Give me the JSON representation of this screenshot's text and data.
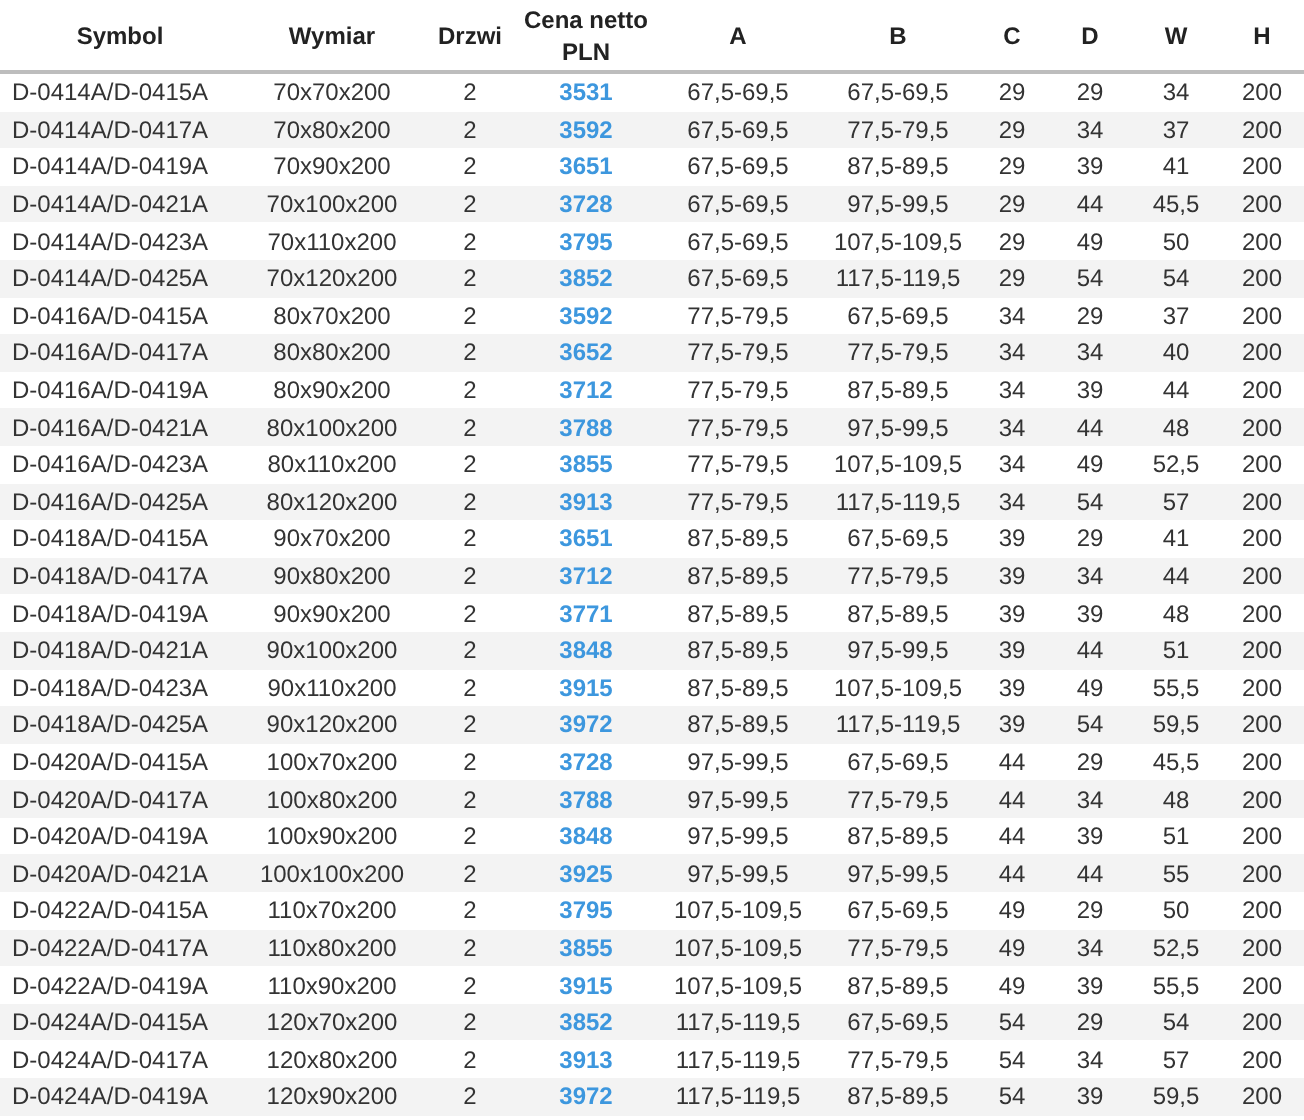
{
  "table": {
    "columns": [
      {
        "label": "Symbol",
        "kind": "text"
      },
      {
        "label": "Wymiar",
        "kind": "text"
      },
      {
        "label": "Drzwi",
        "kind": "text"
      },
      {
        "label": "Cena netto PLN",
        "kind": "price"
      },
      {
        "label": "A",
        "kind": "text"
      },
      {
        "label": "B",
        "kind": "text"
      },
      {
        "label": "C",
        "kind": "text"
      },
      {
        "label": "D",
        "kind": "text"
      },
      {
        "label": "W",
        "kind": "text"
      },
      {
        "label": "H",
        "kind": "text"
      }
    ],
    "rows": [
      [
        "D-0414A/D-0415A",
        "70x70x200",
        "2",
        "3531",
        "67,5-69,5",
        "67,5-69,5",
        "29",
        "29",
        "34",
        "200"
      ],
      [
        "D-0414A/D-0417A",
        "70x80x200",
        "2",
        "3592",
        "67,5-69,5",
        "77,5-79,5",
        "29",
        "34",
        "37",
        "200"
      ],
      [
        "D-0414A/D-0419A",
        "70x90x200",
        "2",
        "3651",
        "67,5-69,5",
        "87,5-89,5",
        "29",
        "39",
        "41",
        "200"
      ],
      [
        "D-0414A/D-0421A",
        "70x100x200",
        "2",
        "3728",
        "67,5-69,5",
        "97,5-99,5",
        "29",
        "44",
        "45,5",
        "200"
      ],
      [
        "D-0414A/D-0423A",
        "70x110x200",
        "2",
        "3795",
        "67,5-69,5",
        "107,5-109,5",
        "29",
        "49",
        "50",
        "200"
      ],
      [
        "D-0414A/D-0425A",
        "70x120x200",
        "2",
        "3852",
        "67,5-69,5",
        "117,5-119,5",
        "29",
        "54",
        "54",
        "200"
      ],
      [
        "D-0416A/D-0415A",
        "80x70x200",
        "2",
        "3592",
        "77,5-79,5",
        "67,5-69,5",
        "34",
        "29",
        "37",
        "200"
      ],
      [
        "D-0416A/D-0417A",
        "80x80x200",
        "2",
        "3652",
        "77,5-79,5",
        "77,5-79,5",
        "34",
        "34",
        "40",
        "200"
      ],
      [
        "D-0416A/D-0419A",
        "80x90x200",
        "2",
        "3712",
        "77,5-79,5",
        "87,5-89,5",
        "34",
        "39",
        "44",
        "200"
      ],
      [
        "D-0416A/D-0421A",
        "80x100x200",
        "2",
        "3788",
        "77,5-79,5",
        "97,5-99,5",
        "34",
        "44",
        "48",
        "200"
      ],
      [
        "D-0416A/D-0423A",
        "80x110x200",
        "2",
        "3855",
        "77,5-79,5",
        "107,5-109,5",
        "34",
        "49",
        "52,5",
        "200"
      ],
      [
        "D-0416A/D-0425A",
        "80x120x200",
        "2",
        "3913",
        "77,5-79,5",
        "117,5-119,5",
        "34",
        "54",
        "57",
        "200"
      ],
      [
        "D-0418A/D-0415A",
        "90x70x200",
        "2",
        "3651",
        "87,5-89,5",
        "67,5-69,5",
        "39",
        "29",
        "41",
        "200"
      ],
      [
        "D-0418A/D-0417A",
        "90x80x200",
        "2",
        "3712",
        "87,5-89,5",
        "77,5-79,5",
        "39",
        "34",
        "44",
        "200"
      ],
      [
        "D-0418A/D-0419A",
        "90x90x200",
        "2",
        "3771",
        "87,5-89,5",
        "87,5-89,5",
        "39",
        "39",
        "48",
        "200"
      ],
      [
        "D-0418A/D-0421A",
        "90x100x200",
        "2",
        "3848",
        "87,5-89,5",
        "97,5-99,5",
        "39",
        "44",
        "51",
        "200"
      ],
      [
        "D-0418A/D-0423A",
        "90x110x200",
        "2",
        "3915",
        "87,5-89,5",
        "107,5-109,5",
        "39",
        "49",
        "55,5",
        "200"
      ],
      [
        "D-0418A/D-0425A",
        "90x120x200",
        "2",
        "3972",
        "87,5-89,5",
        "117,5-119,5",
        "39",
        "54",
        "59,5",
        "200"
      ],
      [
        "D-0420A/D-0415A",
        "100x70x200",
        "2",
        "3728",
        "97,5-99,5",
        "67,5-69,5",
        "44",
        "29",
        "45,5",
        "200"
      ],
      [
        "D-0420A/D-0417A",
        "100x80x200",
        "2",
        "3788",
        "97,5-99,5",
        "77,5-79,5",
        "44",
        "34",
        "48",
        "200"
      ],
      [
        "D-0420A/D-0419A",
        "100x90x200",
        "2",
        "3848",
        "97,5-99,5",
        "87,5-89,5",
        "44",
        "39",
        "51",
        "200"
      ],
      [
        "D-0420A/D-0421A",
        "100x100x200",
        "2",
        "3925",
        "97,5-99,5",
        "97,5-99,5",
        "44",
        "44",
        "55",
        "200"
      ],
      [
        "D-0422A/D-0415A",
        "110x70x200",
        "2",
        "3795",
        "107,5-109,5",
        "67,5-69,5",
        "49",
        "29",
        "50",
        "200"
      ],
      [
        "D-0422A/D-0417A",
        "110x80x200",
        "2",
        "3855",
        "107,5-109,5",
        "77,5-79,5",
        "49",
        "34",
        "52,5",
        "200"
      ],
      [
        "D-0422A/D-0419A",
        "110x90x200",
        "2",
        "3915",
        "107,5-109,5",
        "87,5-89,5",
        "49",
        "39",
        "55,5",
        "200"
      ],
      [
        "D-0424A/D-0415A",
        "120x70x200",
        "2",
        "3852",
        "117,5-119,5",
        "67,5-69,5",
        "54",
        "29",
        "54",
        "200"
      ],
      [
        "D-0424A/D-0417A",
        "120x80x200",
        "2",
        "3913",
        "117,5-119,5",
        "77,5-79,5",
        "54",
        "34",
        "57",
        "200"
      ],
      [
        "D-0424A/D-0419A",
        "120x90x200",
        "2",
        "3972",
        "117,5-119,5",
        "87,5-89,5",
        "54",
        "39",
        "59,5",
        "200"
      ]
    ]
  }
}
